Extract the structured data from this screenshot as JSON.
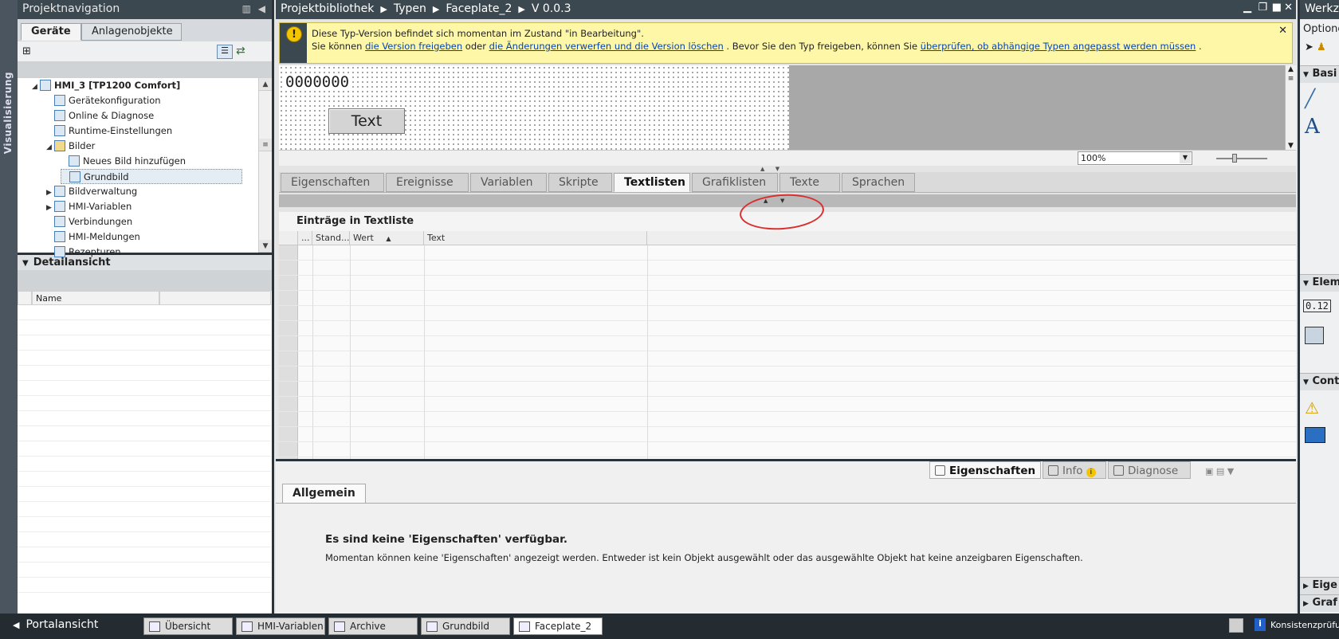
{
  "vstrip": {
    "label": "Visualisierung"
  },
  "nav": {
    "title": "Projektnavigation",
    "tabs": [
      "Geräte",
      "Anlagenobjekte"
    ],
    "tree": [
      {
        "label": "HMI_3 [TP1200 Comfort]",
        "indent": 0,
        "expanded": true,
        "bold": true
      },
      {
        "label": "Gerätekonfiguration",
        "indent": 1
      },
      {
        "label": "Online & Diagnose",
        "indent": 1
      },
      {
        "label": "Runtime-Einstellungen",
        "indent": 1
      },
      {
        "label": "Bilder",
        "indent": 1,
        "expanded": true
      },
      {
        "label": "Neues Bild hinzufügen",
        "indent": 2
      },
      {
        "label": "Grundbild",
        "indent": 2,
        "selected": true
      },
      {
        "label": "Bildverwaltung",
        "indent": 1,
        "collapsed": true
      },
      {
        "label": "HMI-Variablen",
        "indent": 1,
        "collapsed": true
      },
      {
        "label": "Verbindungen",
        "indent": 1
      },
      {
        "label": "HMI-Meldungen",
        "indent": 1
      },
      {
        "label": "Rezepturen",
        "indent": 1
      }
    ],
    "detail_title": "Detailansicht",
    "detail_col": "Name"
  },
  "crumbs": [
    "Projektbibliothek",
    "Typen",
    "Faceplate_2",
    "V 0.0.3"
  ],
  "warning": {
    "line1": "Diese Typ-Version befindet sich momentan im Zustand \"in Bearbeitung\".",
    "l2a": "Sie können",
    "link1": "die Version freigeben",
    "l2b": "oder",
    "link2": "die Änderungen verwerfen und die Version löschen",
    "l2c": ". Bevor Sie den Typ freigeben, können Sie",
    "link3": "überprüfen, ob abhängige Typen angepasst werden müssen",
    "l2d": "."
  },
  "canvas": {
    "number": "0000000",
    "button": "Text",
    "zoom": "100%"
  },
  "ptabs": [
    "Eigenschaften",
    "Ereignisse",
    "Variablen",
    "Skripte",
    "Textlisten",
    "Grafiklisten",
    "Texte",
    "Sprachen"
  ],
  "ptab_active": "Textlisten",
  "entries": {
    "title": "Einträge in Textliste",
    "cols": [
      "...",
      "Stand...",
      "Wert",
      "Text"
    ]
  },
  "inspector": {
    "tabs": [
      "Eigenschaften",
      "Info",
      "Diagnose"
    ],
    "sub": "Allgemein",
    "msg_title": "Es sind keine 'Eigenschaften' verfügbar.",
    "msg_body": "Momentan können keine 'Eigenschaften' angezeigt werden. Entweder ist kein Objekt ausgewählt oder das ausgewählte Objekt hat keine anzeigbaren Eigenschaften."
  },
  "right": {
    "title": "Werkze",
    "optionen": "Optione",
    "sections": [
      "Basi",
      "Elem",
      "Cont",
      "Eige",
      "Graf"
    ]
  },
  "taskbar": {
    "portal": "Portalansicht",
    "items": [
      "Übersicht",
      "HMI-Variablen",
      "Archive",
      "Grundbild",
      "Faceplate_2"
    ],
    "active": "Faceplate_2",
    "status": "Konsistenzprüfu"
  },
  "colors": {
    "dark": "#3c4850",
    "warn": "#fff7a8",
    "link": "#0645ad",
    "annotation": "#d83030"
  }
}
